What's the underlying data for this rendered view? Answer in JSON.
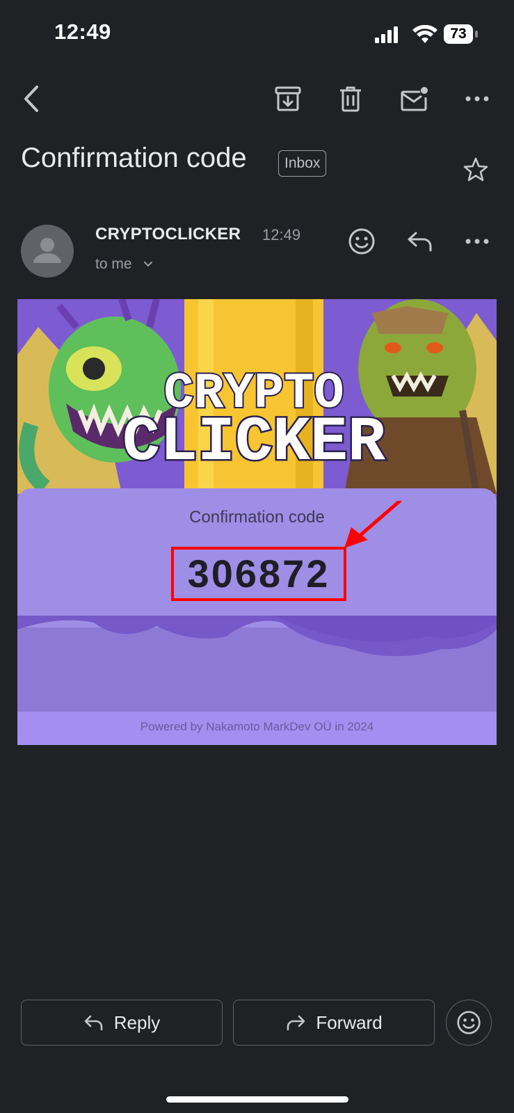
{
  "status_bar": {
    "time": "12:49",
    "battery": "73"
  },
  "toolbar": {
    "back_icon": "chevron-left-icon",
    "archive_icon": "archive-icon",
    "delete_icon": "trash-icon",
    "mark_unread_icon": "mail-unread-icon",
    "more_icon": "more-horizontal-icon"
  },
  "email": {
    "subject": "Confirmation code",
    "label": "Inbox",
    "sender": "CRYPTOCLICKER",
    "time": "12:49",
    "recipient": "to me"
  },
  "content": {
    "banner_title_line1": "CRYPTO",
    "banner_title_line2": "CLICKER",
    "code_label": "Confirmation code",
    "code": "306872",
    "footer": "Powered by Nakamoto MarkDev OÜ in 2024"
  },
  "actions": {
    "reply_label": "Reply",
    "forward_label": "Forward"
  },
  "colors": {
    "background": "#202124",
    "card": "#8f79d6",
    "highlight": "#ff0000"
  }
}
